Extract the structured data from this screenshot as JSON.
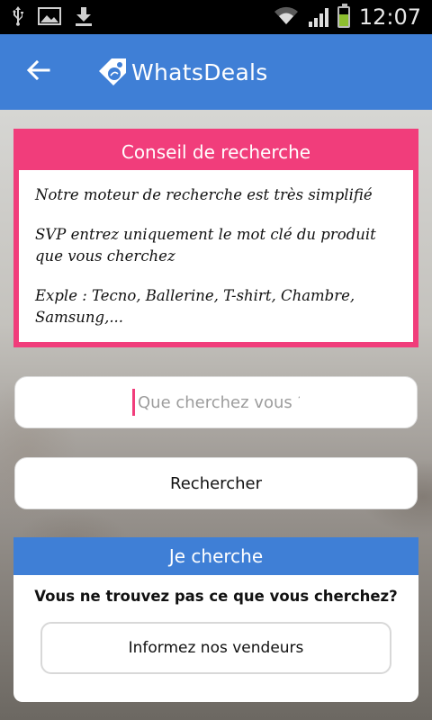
{
  "status_bar": {
    "time": "12:07",
    "icons": [
      "usb-icon",
      "image-icon",
      "download-icon",
      "wifi-icon",
      "signal-icon",
      "battery-icon"
    ]
  },
  "app_bar": {
    "title": "WhatsDeals",
    "back_icon": "arrow-left-icon",
    "logo_icon": "tag-logo-icon"
  },
  "tip_card": {
    "title": "Conseil de recherche",
    "lines": [
      "Notre moteur de recherche est très simplifié",
      "SVP entrez uniquement le mot clé du produit que vous cherchez",
      "Exple : Tecno, Ballerine, T-shirt, Chambre, Samsung,..."
    ]
  },
  "search": {
    "placeholder": "Que cherchez vous ?",
    "value": ""
  },
  "search_button": {
    "label": "Rechercher"
  },
  "request_card": {
    "title": "Je cherche",
    "question": "Vous ne trouvez pas ce que vous cherchez?",
    "button_label": "Informez nos vendeurs"
  },
  "colors": {
    "primary": "#3f7fd6",
    "accent": "#f13d7b"
  }
}
